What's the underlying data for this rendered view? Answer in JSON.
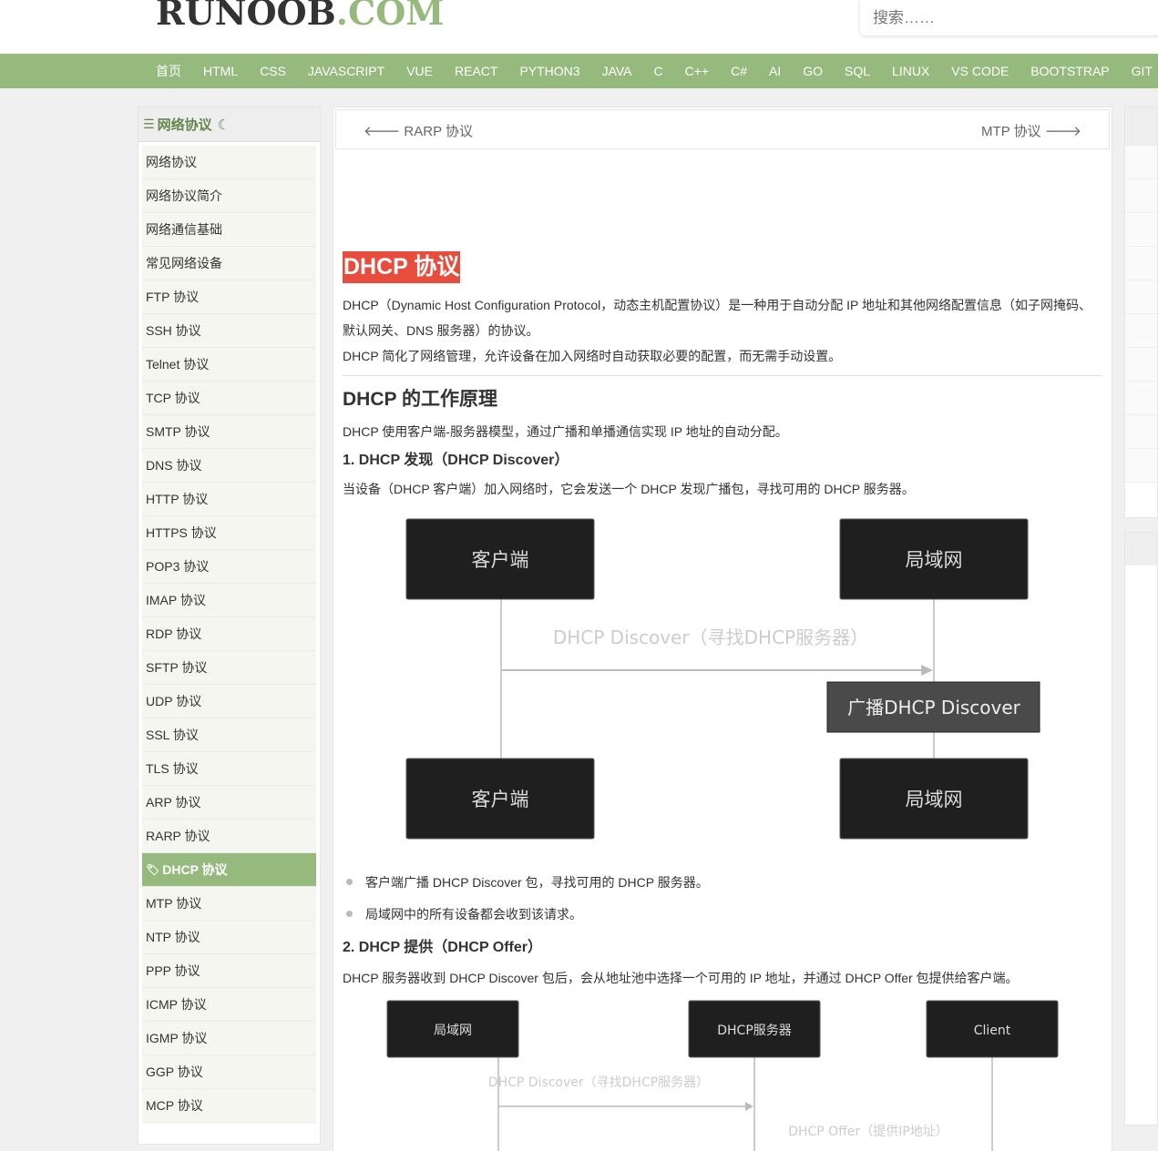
{
  "header": {
    "logo_main": "RUNOOB",
    "logo_dot": ".COM",
    "search_placeholder": "搜索……"
  },
  "nav": [
    "首页",
    "HTML",
    "CSS",
    "JAVASCRIPT",
    "VUE",
    "REACT",
    "PYTHON3",
    "JAVA",
    "C",
    "C++",
    "C#",
    "AI",
    "GO",
    "SQL",
    "LINUX",
    "VS CODE",
    "BOOTSTRAP",
    "GIT"
  ],
  "sidebar": {
    "title": "网络协议",
    "items": [
      "网络协议",
      "网络协议简介",
      "网络通信基础",
      "常见网络设备",
      "FTP 协议",
      "SSH 协议",
      "Telnet 协议",
      "TCP 协议",
      "SMTP 协议",
      "DNS 协议",
      "HTTP 协议",
      "HTTPS 协议",
      "POP3 协议",
      "IMAP 协议",
      "RDP 协议",
      "SFTP 协议",
      "UDP 协议",
      "SSL 协议",
      "TLS 协议",
      "ARP 协议",
      "RARP 协议",
      "DHCP 协议",
      "MTP 协议",
      "NTP 协议",
      "PPP 协议",
      "ICMP 协议",
      "IGMP 协议",
      "GGP 协议",
      "MCP 协议"
    ],
    "active_index": 21
  },
  "prevnext": {
    "prev": "RARP 协议",
    "next": "MTP 协议"
  },
  "article": {
    "title": "DHCP 协议",
    "intro1": "DHCP（Dynamic Host Configuration Protocol，动态主机配置协议）是一种用于自动分配 IP 地址和其他网络配置信息（如子网掩码、默认网关、DNS 服务器）的协议。",
    "intro2": "DHCP 简化了网络管理，允许设备在加入网络时自动获取必要的配置，而无需手动设置。",
    "h2": "DHCP 的工作原理",
    "h2_text": "DHCP 使用客户端-服务器模型，通过广播和单播通信实现 IP 地址的自动分配。",
    "step1_title": "1. DHCP 发现（DHCP Discover）",
    "step1_text": "当设备（DHCP 客户端）加入网络时，它会发送一个 DHCP 发现广播包，寻找可用的 DHCP 服务器。",
    "diagram1": {
      "client": "客户端",
      "lan": "局域网",
      "message": "DHCP Discover（寻找DHCP服务器）",
      "note": "广播DHCP Discover"
    },
    "step1_bullets": [
      "客户端广播 DHCP Discover 包，寻找可用的 DHCP 服务器。",
      "局域网中的所有设备都会收到该请求。"
    ],
    "step2_title": "2. DHCP 提供（DHCP Offer）",
    "step2_text": "DHCP 服务器收到 DHCP Discover 包后，会从地址池中选择一个可用的 IP 地址，并通过 DHCP Offer 包提供给客户端。",
    "diagram2": {
      "lan": "局域网",
      "server": "DHCP服务器",
      "client": "Client",
      "msg1": "DHCP Discover（寻找DHCP服务器）",
      "msg2": "DHCP Offer（提供IP地址）"
    }
  },
  "colors": {
    "brand": "#96b97d",
    "title_bg": "#e74c3c",
    "box_bg": "#1f1f1f",
    "note_bg": "#4a4a4a"
  }
}
